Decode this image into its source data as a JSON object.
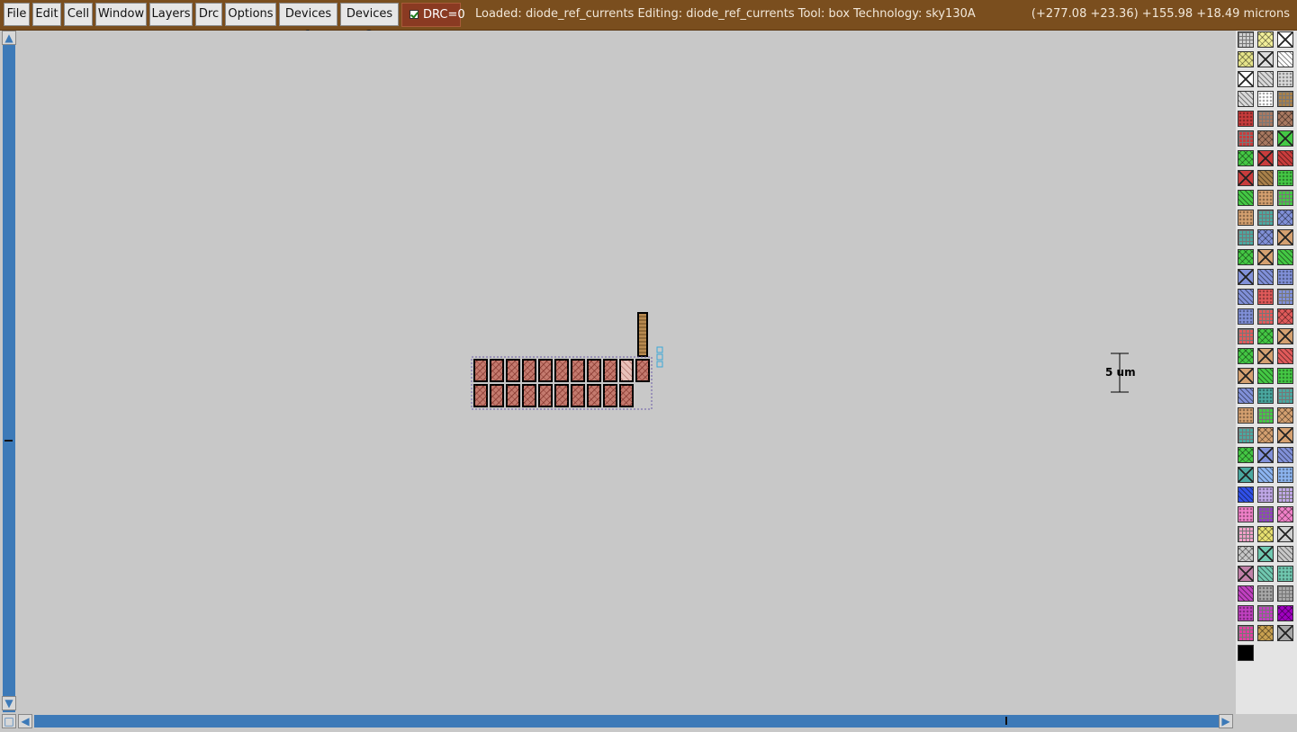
{
  "menubar": {
    "items": [
      "File",
      "Edit",
      "Cell",
      "Window",
      "Layers",
      "Drc",
      "Options",
      "Devices 1",
      "Devices 2"
    ],
    "drc_label": "DRC=0",
    "drc_checked": true,
    "status": "Loaded: diode_ref_currents Editing: diode_ref_currents Tool: box  Technology: sky130A",
    "coords": "(+277.08 +23.36) +155.98 +18.49 microns"
  },
  "layout": {
    "scale_bar_label": "5 um",
    "colors": {
      "background": "#c8c8c8",
      "menubar": "#7a4e1e",
      "drc_badge": "#8a3a22",
      "scroll": "#3d7ab8",
      "cell_fill": "#c47a6e",
      "cell_hatch": "#7a2a22",
      "box_outline": "#000000",
      "selection": "#3aa8d8"
    }
  },
  "palette": {
    "colors": [
      "#d0d0d0",
      "#f2ef9a",
      "#ffffff",
      "#e6e48a",
      "#dcdcdc",
      "#ffffff",
      "#ffffff",
      "#d8d8d8",
      "#d8d8d8",
      "#d8d8d8",
      "#ffffff",
      "#a8804a",
      "#c83c3c",
      "#a87860",
      "#a87860",
      "#c83c3c",
      "#a87860",
      "#44c844",
      "#44c844",
      "#c83c3c",
      "#c83c3c",
      "#c83c3c",
      "#a8804a",
      "#44c844",
      "#44c844",
      "#d4a070",
      "#44c844",
      "#d4a070",
      "#4aa8a0",
      "#8090d8",
      "#4aa8a0",
      "#8090d8",
      "#d4a070",
      "#44c844",
      "#d4a070",
      "#44c844",
      "#8090d8",
      "#8090d8",
      "#8090d8",
      "#8090d8",
      "#e05a5a",
      "#8090d8",
      "#8090d8",
      "#e05a5a",
      "#e05a5a",
      "#e05a5a",
      "#44c844",
      "#d4a070",
      "#44c844",
      "#d4a070",
      "#e05a5a",
      "#d4a070",
      "#44c844",
      "#44c844",
      "#8090d8",
      "#4aa8a0",
      "#4aa8a0",
      "#d4a070",
      "#44c844",
      "#d4a070",
      "#4aa8a0",
      "#d4a070",
      "#d4a070",
      "#44c844",
      "#8090d8",
      "#8090d8",
      "#4aa8a0",
      "#8cb4f0",
      "#8cb4f0",
      "#3050e8",
      "#c0a8e8",
      "#c0a8e8",
      "#f080c8",
      "#9040c0",
      "#f080c8",
      "#f0a0c8",
      "#e8e070",
      "#d0d0d0",
      "#c8c8c8",
      "#70c8b0",
      "#c8c8c8",
      "#c080a8",
      "#70c8b0",
      "#70c8b0",
      "#c040c0",
      "#a8a8a8",
      "#a8a8a8",
      "#c040c0",
      "#c040c0",
      "#a000c0",
      "#e040a0",
      "#c8a050",
      "#a8a8a8",
      "#000000"
    ]
  }
}
